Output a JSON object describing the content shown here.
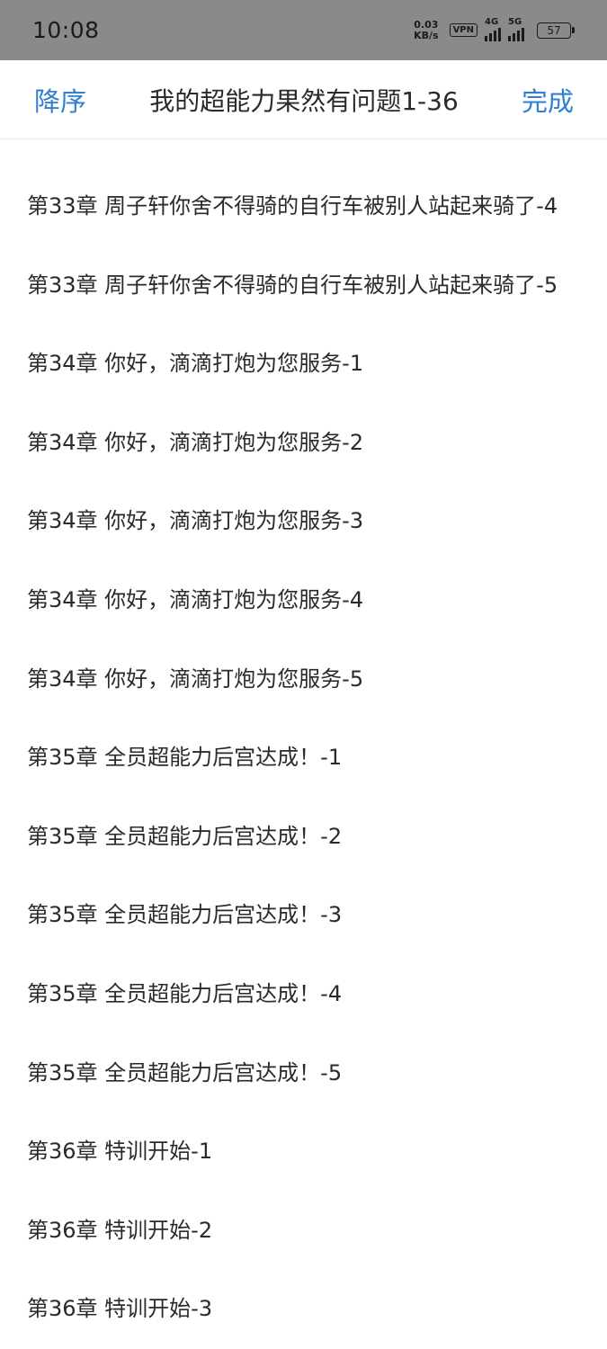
{
  "status_bar": {
    "time": "10:08",
    "net_speed_value": "0.03",
    "net_speed_unit": "KB/s",
    "vpn": "VPN",
    "signal_1_tag": "4G",
    "signal_2_tag": "5G",
    "battery": "57"
  },
  "header": {
    "sort_label": "降序",
    "title": "我的超能力果然有问题1-36",
    "done_label": "完成"
  },
  "chapters": [
    "第33章 周子轩你舍不得骑的自行车被别人站起来骑了-4",
    "第33章 周子轩你舍不得骑的自行车被别人站起来骑了-5",
    "第34章 你好，滴滴打炮为您服务-1",
    "第34章 你好，滴滴打炮为您服务-2",
    "第34章 你好，滴滴打炮为您服务-3",
    "第34章 你好，滴滴打炮为您服务-4",
    "第34章 你好，滴滴打炮为您服务-5",
    "第35章 全员超能力后宫达成！-1",
    "第35章 全员超能力后宫达成！-2",
    "第35章 全员超能力后宫达成！-3",
    "第35章 全员超能力后宫达成！-4",
    "第35章 全员超能力后宫达成！-5",
    "第36章 特训开始-1",
    "第36章 特训开始-2",
    "第36章 特训开始-3"
  ]
}
